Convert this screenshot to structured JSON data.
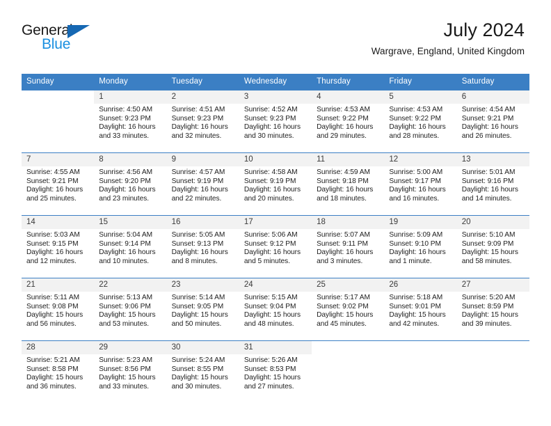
{
  "brand": {
    "name_part1": "General",
    "name_part2": "Blue",
    "accent_color": "#1668b3",
    "blue_text_color": "#1a8fe0"
  },
  "header": {
    "title": "July 2024",
    "subtitle": "Wargrave, England, United Kingdom"
  },
  "calendar": {
    "header_bg": "#3b7fc4",
    "weekdays": [
      "Sunday",
      "Monday",
      "Tuesday",
      "Wednesday",
      "Thursday",
      "Friday",
      "Saturday"
    ],
    "weeks": [
      [
        {
          "day": "",
          "sunrise": "",
          "sunset": "",
          "daylight_line1": "",
          "daylight_line2": ""
        },
        {
          "day": "1",
          "sunrise": "Sunrise: 4:50 AM",
          "sunset": "Sunset: 9:23 PM",
          "daylight_line1": "Daylight: 16 hours",
          "daylight_line2": "and 33 minutes."
        },
        {
          "day": "2",
          "sunrise": "Sunrise: 4:51 AM",
          "sunset": "Sunset: 9:23 PM",
          "daylight_line1": "Daylight: 16 hours",
          "daylight_line2": "and 32 minutes."
        },
        {
          "day": "3",
          "sunrise": "Sunrise: 4:52 AM",
          "sunset": "Sunset: 9:23 PM",
          "daylight_line1": "Daylight: 16 hours",
          "daylight_line2": "and 30 minutes."
        },
        {
          "day": "4",
          "sunrise": "Sunrise: 4:53 AM",
          "sunset": "Sunset: 9:22 PM",
          "daylight_line1": "Daylight: 16 hours",
          "daylight_line2": "and 29 minutes."
        },
        {
          "day": "5",
          "sunrise": "Sunrise: 4:53 AM",
          "sunset": "Sunset: 9:22 PM",
          "daylight_line1": "Daylight: 16 hours",
          "daylight_line2": "and 28 minutes."
        },
        {
          "day": "6",
          "sunrise": "Sunrise: 4:54 AM",
          "sunset": "Sunset: 9:21 PM",
          "daylight_line1": "Daylight: 16 hours",
          "daylight_line2": "and 26 minutes."
        }
      ],
      [
        {
          "day": "7",
          "sunrise": "Sunrise: 4:55 AM",
          "sunset": "Sunset: 9:21 PM",
          "daylight_line1": "Daylight: 16 hours",
          "daylight_line2": "and 25 minutes."
        },
        {
          "day": "8",
          "sunrise": "Sunrise: 4:56 AM",
          "sunset": "Sunset: 9:20 PM",
          "daylight_line1": "Daylight: 16 hours",
          "daylight_line2": "and 23 minutes."
        },
        {
          "day": "9",
          "sunrise": "Sunrise: 4:57 AM",
          "sunset": "Sunset: 9:19 PM",
          "daylight_line1": "Daylight: 16 hours",
          "daylight_line2": "and 22 minutes."
        },
        {
          "day": "10",
          "sunrise": "Sunrise: 4:58 AM",
          "sunset": "Sunset: 9:19 PM",
          "daylight_line1": "Daylight: 16 hours",
          "daylight_line2": "and 20 minutes."
        },
        {
          "day": "11",
          "sunrise": "Sunrise: 4:59 AM",
          "sunset": "Sunset: 9:18 PM",
          "daylight_line1": "Daylight: 16 hours",
          "daylight_line2": "and 18 minutes."
        },
        {
          "day": "12",
          "sunrise": "Sunrise: 5:00 AM",
          "sunset": "Sunset: 9:17 PM",
          "daylight_line1": "Daylight: 16 hours",
          "daylight_line2": "and 16 minutes."
        },
        {
          "day": "13",
          "sunrise": "Sunrise: 5:01 AM",
          "sunset": "Sunset: 9:16 PM",
          "daylight_line1": "Daylight: 16 hours",
          "daylight_line2": "and 14 minutes."
        }
      ],
      [
        {
          "day": "14",
          "sunrise": "Sunrise: 5:03 AM",
          "sunset": "Sunset: 9:15 PM",
          "daylight_line1": "Daylight: 16 hours",
          "daylight_line2": "and 12 minutes."
        },
        {
          "day": "15",
          "sunrise": "Sunrise: 5:04 AM",
          "sunset": "Sunset: 9:14 PM",
          "daylight_line1": "Daylight: 16 hours",
          "daylight_line2": "and 10 minutes."
        },
        {
          "day": "16",
          "sunrise": "Sunrise: 5:05 AM",
          "sunset": "Sunset: 9:13 PM",
          "daylight_line1": "Daylight: 16 hours",
          "daylight_line2": "and 8 minutes."
        },
        {
          "day": "17",
          "sunrise": "Sunrise: 5:06 AM",
          "sunset": "Sunset: 9:12 PM",
          "daylight_line1": "Daylight: 16 hours",
          "daylight_line2": "and 5 minutes."
        },
        {
          "day": "18",
          "sunrise": "Sunrise: 5:07 AM",
          "sunset": "Sunset: 9:11 PM",
          "daylight_line1": "Daylight: 16 hours",
          "daylight_line2": "and 3 minutes."
        },
        {
          "day": "19",
          "sunrise": "Sunrise: 5:09 AM",
          "sunset": "Sunset: 9:10 PM",
          "daylight_line1": "Daylight: 16 hours",
          "daylight_line2": "and 1 minute."
        },
        {
          "day": "20",
          "sunrise": "Sunrise: 5:10 AM",
          "sunset": "Sunset: 9:09 PM",
          "daylight_line1": "Daylight: 15 hours",
          "daylight_line2": "and 58 minutes."
        }
      ],
      [
        {
          "day": "21",
          "sunrise": "Sunrise: 5:11 AM",
          "sunset": "Sunset: 9:08 PM",
          "daylight_line1": "Daylight: 15 hours",
          "daylight_line2": "and 56 minutes."
        },
        {
          "day": "22",
          "sunrise": "Sunrise: 5:13 AM",
          "sunset": "Sunset: 9:06 PM",
          "daylight_line1": "Daylight: 15 hours",
          "daylight_line2": "and 53 minutes."
        },
        {
          "day": "23",
          "sunrise": "Sunrise: 5:14 AM",
          "sunset": "Sunset: 9:05 PM",
          "daylight_line1": "Daylight: 15 hours",
          "daylight_line2": "and 50 minutes."
        },
        {
          "day": "24",
          "sunrise": "Sunrise: 5:15 AM",
          "sunset": "Sunset: 9:04 PM",
          "daylight_line1": "Daylight: 15 hours",
          "daylight_line2": "and 48 minutes."
        },
        {
          "day": "25",
          "sunrise": "Sunrise: 5:17 AM",
          "sunset": "Sunset: 9:02 PM",
          "daylight_line1": "Daylight: 15 hours",
          "daylight_line2": "and 45 minutes."
        },
        {
          "day": "26",
          "sunrise": "Sunrise: 5:18 AM",
          "sunset": "Sunset: 9:01 PM",
          "daylight_line1": "Daylight: 15 hours",
          "daylight_line2": "and 42 minutes."
        },
        {
          "day": "27",
          "sunrise": "Sunrise: 5:20 AM",
          "sunset": "Sunset: 8:59 PM",
          "daylight_line1": "Daylight: 15 hours",
          "daylight_line2": "and 39 minutes."
        }
      ],
      [
        {
          "day": "28",
          "sunrise": "Sunrise: 5:21 AM",
          "sunset": "Sunset: 8:58 PM",
          "daylight_line1": "Daylight: 15 hours",
          "daylight_line2": "and 36 minutes."
        },
        {
          "day": "29",
          "sunrise": "Sunrise: 5:23 AM",
          "sunset": "Sunset: 8:56 PM",
          "daylight_line1": "Daylight: 15 hours",
          "daylight_line2": "and 33 minutes."
        },
        {
          "day": "30",
          "sunrise": "Sunrise: 5:24 AM",
          "sunset": "Sunset: 8:55 PM",
          "daylight_line1": "Daylight: 15 hours",
          "daylight_line2": "and 30 minutes."
        },
        {
          "day": "31",
          "sunrise": "Sunrise: 5:26 AM",
          "sunset": "Sunset: 8:53 PM",
          "daylight_line1": "Daylight: 15 hours",
          "daylight_line2": "and 27 minutes."
        },
        {
          "day": "",
          "sunrise": "",
          "sunset": "",
          "daylight_line1": "",
          "daylight_line2": ""
        },
        {
          "day": "",
          "sunrise": "",
          "sunset": "",
          "daylight_line1": "",
          "daylight_line2": ""
        },
        {
          "day": "",
          "sunrise": "",
          "sunset": "",
          "daylight_line1": "",
          "daylight_line2": ""
        }
      ]
    ]
  }
}
